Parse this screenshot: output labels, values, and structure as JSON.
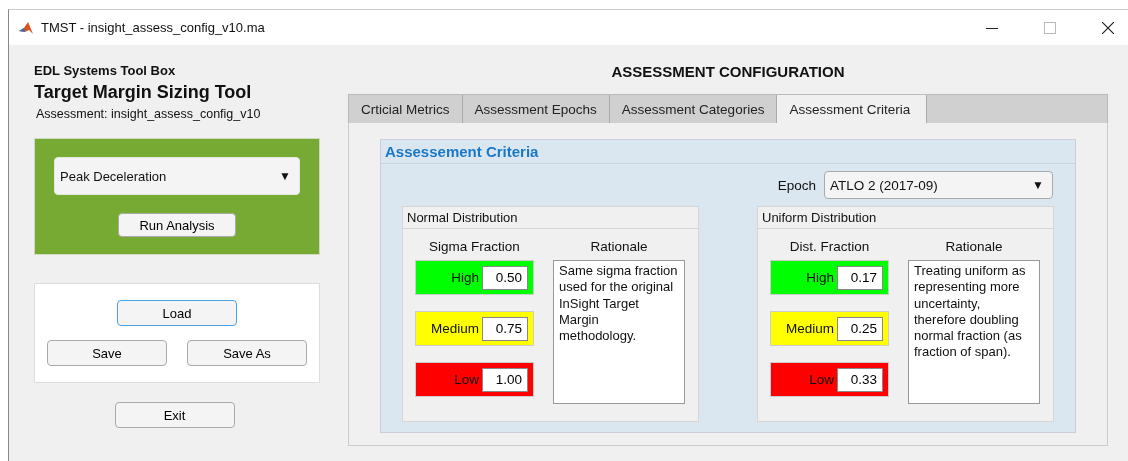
{
  "window": {
    "title": "TMST - insight_assess_config_v10.ma"
  },
  "sidebar": {
    "toolbox": "EDL Systems Tool Box",
    "tool_title": "Target Margin Sizing Tool",
    "assessment": "Assessment: insight_assess_config_v10",
    "metric_dropdown": {
      "value": "Peak Deceleration",
      "arrow": "▼"
    },
    "run_button": "Run Analysis",
    "file_buttons": [
      {
        "label": "Load",
        "selected": true
      },
      {
        "label": "Save",
        "selected": false
      },
      {
        "label": "Save As",
        "selected": false
      }
    ],
    "exit_button": "Exit"
  },
  "heading": "ASSESSMENT CONFIGURATION",
  "tabs": [
    {
      "label": "Crticial Metrics",
      "selected": false
    },
    {
      "label": "Assessment Epochs",
      "selected": false
    },
    {
      "label": "Assessment Categories",
      "selected": false
    },
    {
      "label": "Assessment Criteria",
      "selected": true
    }
  ],
  "criteria_panel": {
    "title": "Assessement Criteria",
    "epoch_label": "Epoch",
    "epoch_dropdown": {
      "value": "ATLO 2 (2017-09)",
      "arrow": "▼"
    },
    "groups": [
      {
        "title": "Normal Distribution",
        "column_label": "Sigma Fraction",
        "rationale_label": "Rationale",
        "rationale": "Same sigma fraction used for the original InSight Target Margin methodology.",
        "levels": [
          {
            "label": "High",
            "value": "0.50",
            "color": "#00ff00"
          },
          {
            "label": "Medium",
            "value": "0.75",
            "color": "#ffff00"
          },
          {
            "label": "Low",
            "value": "1.00",
            "color": "#ff0000"
          }
        ]
      },
      {
        "title": "Uniform Distribution",
        "column_label": "Dist. Fraction",
        "rationale_label": "Rationale",
        "rationale": "Treating uniform as representing more uncertainty, therefore doubling normal fraction (as fraction of span).",
        "levels": [
          {
            "label": "High",
            "value": "0.17",
            "color": "#00ff00"
          },
          {
            "label": "Medium",
            "value": "0.25",
            "color": "#ffff00"
          },
          {
            "label": "Low",
            "value": "0.33",
            "color": "#ff0000"
          }
        ]
      }
    ]
  }
}
